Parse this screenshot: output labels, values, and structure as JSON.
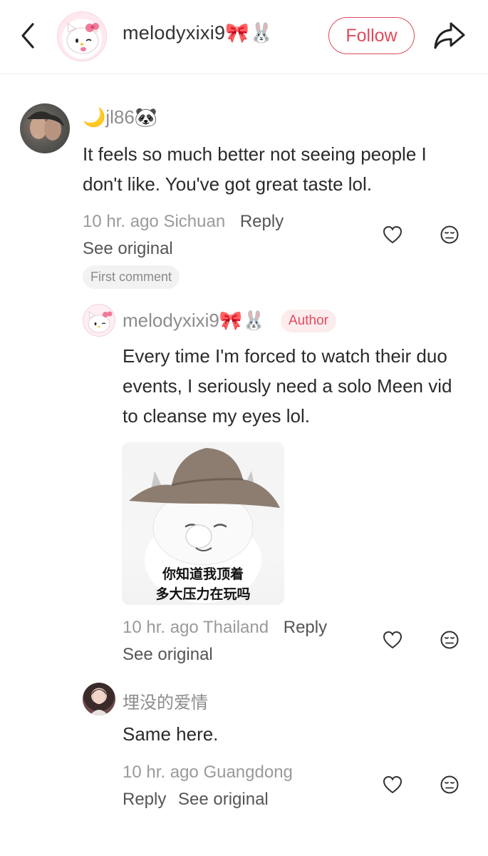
{
  "header": {
    "username": "melodyxixi9🎀🐰",
    "follow_label": "Follow"
  },
  "comments": [
    {
      "username": "🌙jl86🐼",
      "text": "It feels so much better not seeing people I don't like. You've got great taste lol.",
      "time": "10 hr. ago",
      "location": "Sichuan",
      "reply_label": "Reply",
      "see_original": "See original",
      "badge": "First comment"
    },
    {
      "username": "melodyxixi9🎀🐰",
      "badge": "Author",
      "text": "Every time I'm forced to watch their duo events, I seriously need a solo Meen vid to cleanse my eyes lol.",
      "sticker_caption_line1": "你知道我顶着",
      "sticker_caption_line2": "多大压力在玩吗",
      "time": "10 hr. ago",
      "location": "Thailand",
      "reply_label": "Reply",
      "see_original": "See original"
    },
    {
      "username": "埋没的爱情",
      "text": "Same here.",
      "time": "10 hr. ago",
      "location": "Guangdong",
      "reply_label": "Reply",
      "see_original": "See original"
    }
  ],
  "icons": {
    "back": "chevron-left-icon",
    "share": "share-arrow-icon",
    "like": "heart-outline-icon",
    "reaction": "neutral-face-icon"
  },
  "colors": {
    "accent": "#e24a5a",
    "muted_text": "#9a9a9a"
  }
}
